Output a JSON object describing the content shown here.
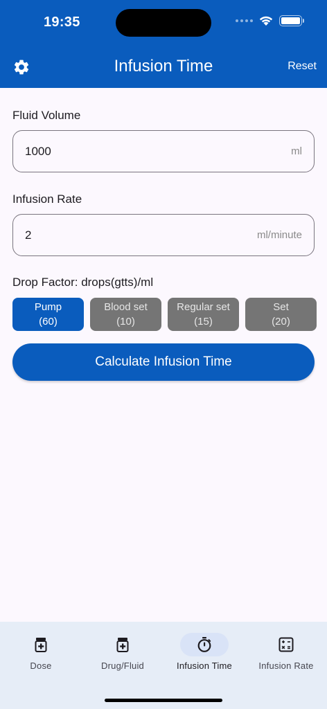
{
  "status_bar": {
    "time": "19:35"
  },
  "header": {
    "title": "Infusion Time",
    "reset_label": "Reset"
  },
  "fluid_volume": {
    "label": "Fluid Volume",
    "value": "1000",
    "unit": "ml"
  },
  "infusion_rate": {
    "label": "Infusion Rate",
    "value": "2",
    "unit": "ml/minute"
  },
  "drop_factor": {
    "label": "Drop Factor: drops(gtts)/ml",
    "options": [
      {
        "name": "Pump",
        "value": "(60)",
        "selected": true
      },
      {
        "name": "Blood set",
        "value": "(10)",
        "selected": false
      },
      {
        "name": "Regular set",
        "value": "(15)",
        "selected": false
      },
      {
        "name": "Set",
        "value": "(20)",
        "selected": false
      }
    ]
  },
  "calculate_label": "Calculate Infusion Time",
  "colors": {
    "primary": "#0a5cbd",
    "chip_inactive": "#757575",
    "nav_bg": "#e6edf7"
  },
  "bottom_nav": {
    "items": [
      {
        "label": "Dose",
        "icon": "medicine-bottle-icon",
        "active": false
      },
      {
        "label": "Drug/Fluid",
        "icon": "medicine-bottle-icon",
        "active": false
      },
      {
        "label": "Infusion Time",
        "icon": "timer-icon",
        "active": true
      },
      {
        "label": "Infusion Rate",
        "icon": "calculator-icon",
        "active": false
      }
    ]
  }
}
